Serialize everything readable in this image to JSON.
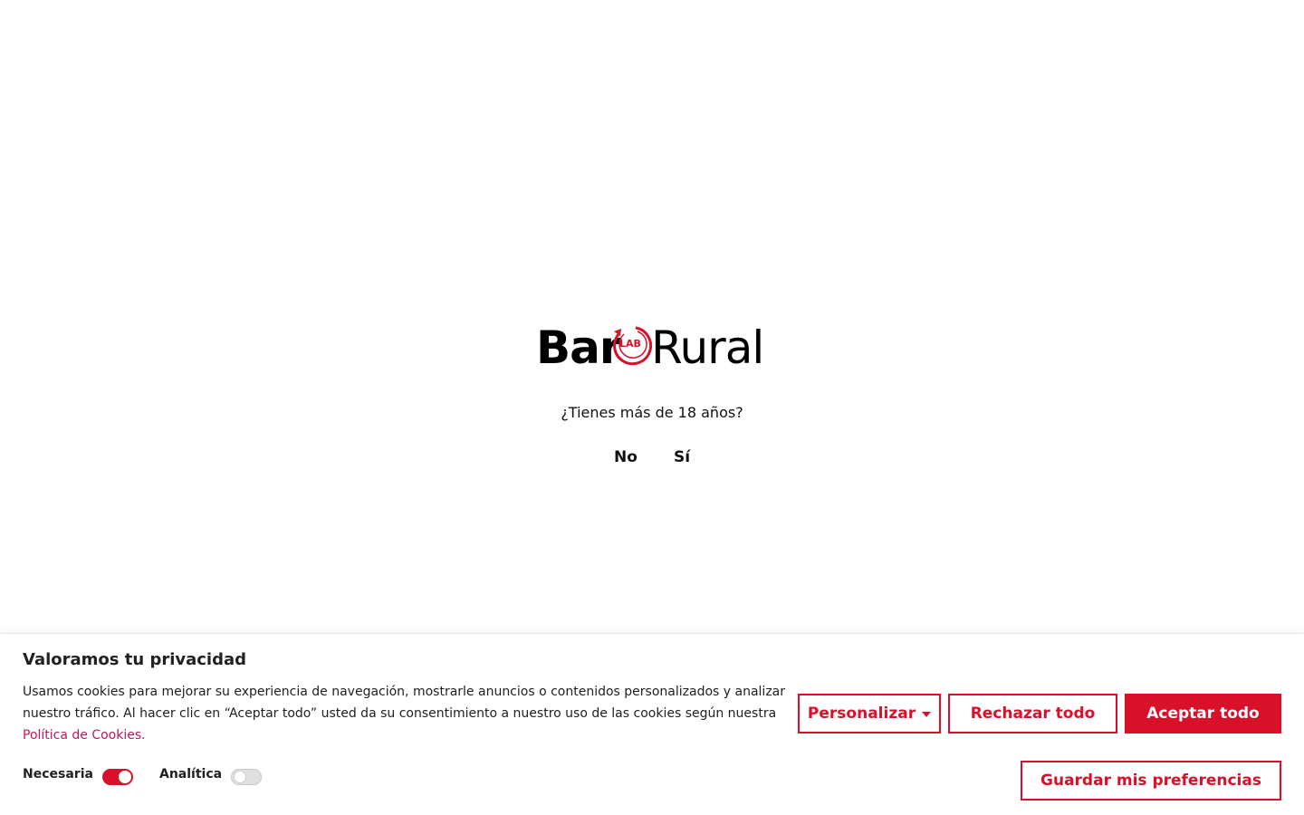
{
  "age_gate": {
    "logo": {
      "word_left": "Bar",
      "mark_text": "LAB",
      "word_right": "Rural"
    },
    "question": "¿Tienes más de 18 años?",
    "no_label": "No",
    "yes_label": "Sí"
  },
  "cookie_banner": {
    "title": "Valoramos tu privacidad",
    "text": "Usamos cookies para mejorar su experiencia de navegación, mostrarle anuncios o contenidos personalizados y analizar nuestro tráfico. Al hacer clic en “Aceptar todo” usted da su consentimiento a nuestro uso de las cookies según nuestra ",
    "policy_link": "Política de Cookies.",
    "toggles": [
      {
        "label": "Necesaria",
        "state": "on"
      },
      {
        "label": "Analítica",
        "state": "off"
      }
    ],
    "buttons": {
      "personalize": "Personalizar",
      "reject": "Rechazar todo",
      "accept": "Aceptar todo",
      "save": "Guardar mis preferencias"
    }
  },
  "colors": {
    "accent": "#d8102a",
    "link": "#c2185b",
    "text": "#212121"
  }
}
